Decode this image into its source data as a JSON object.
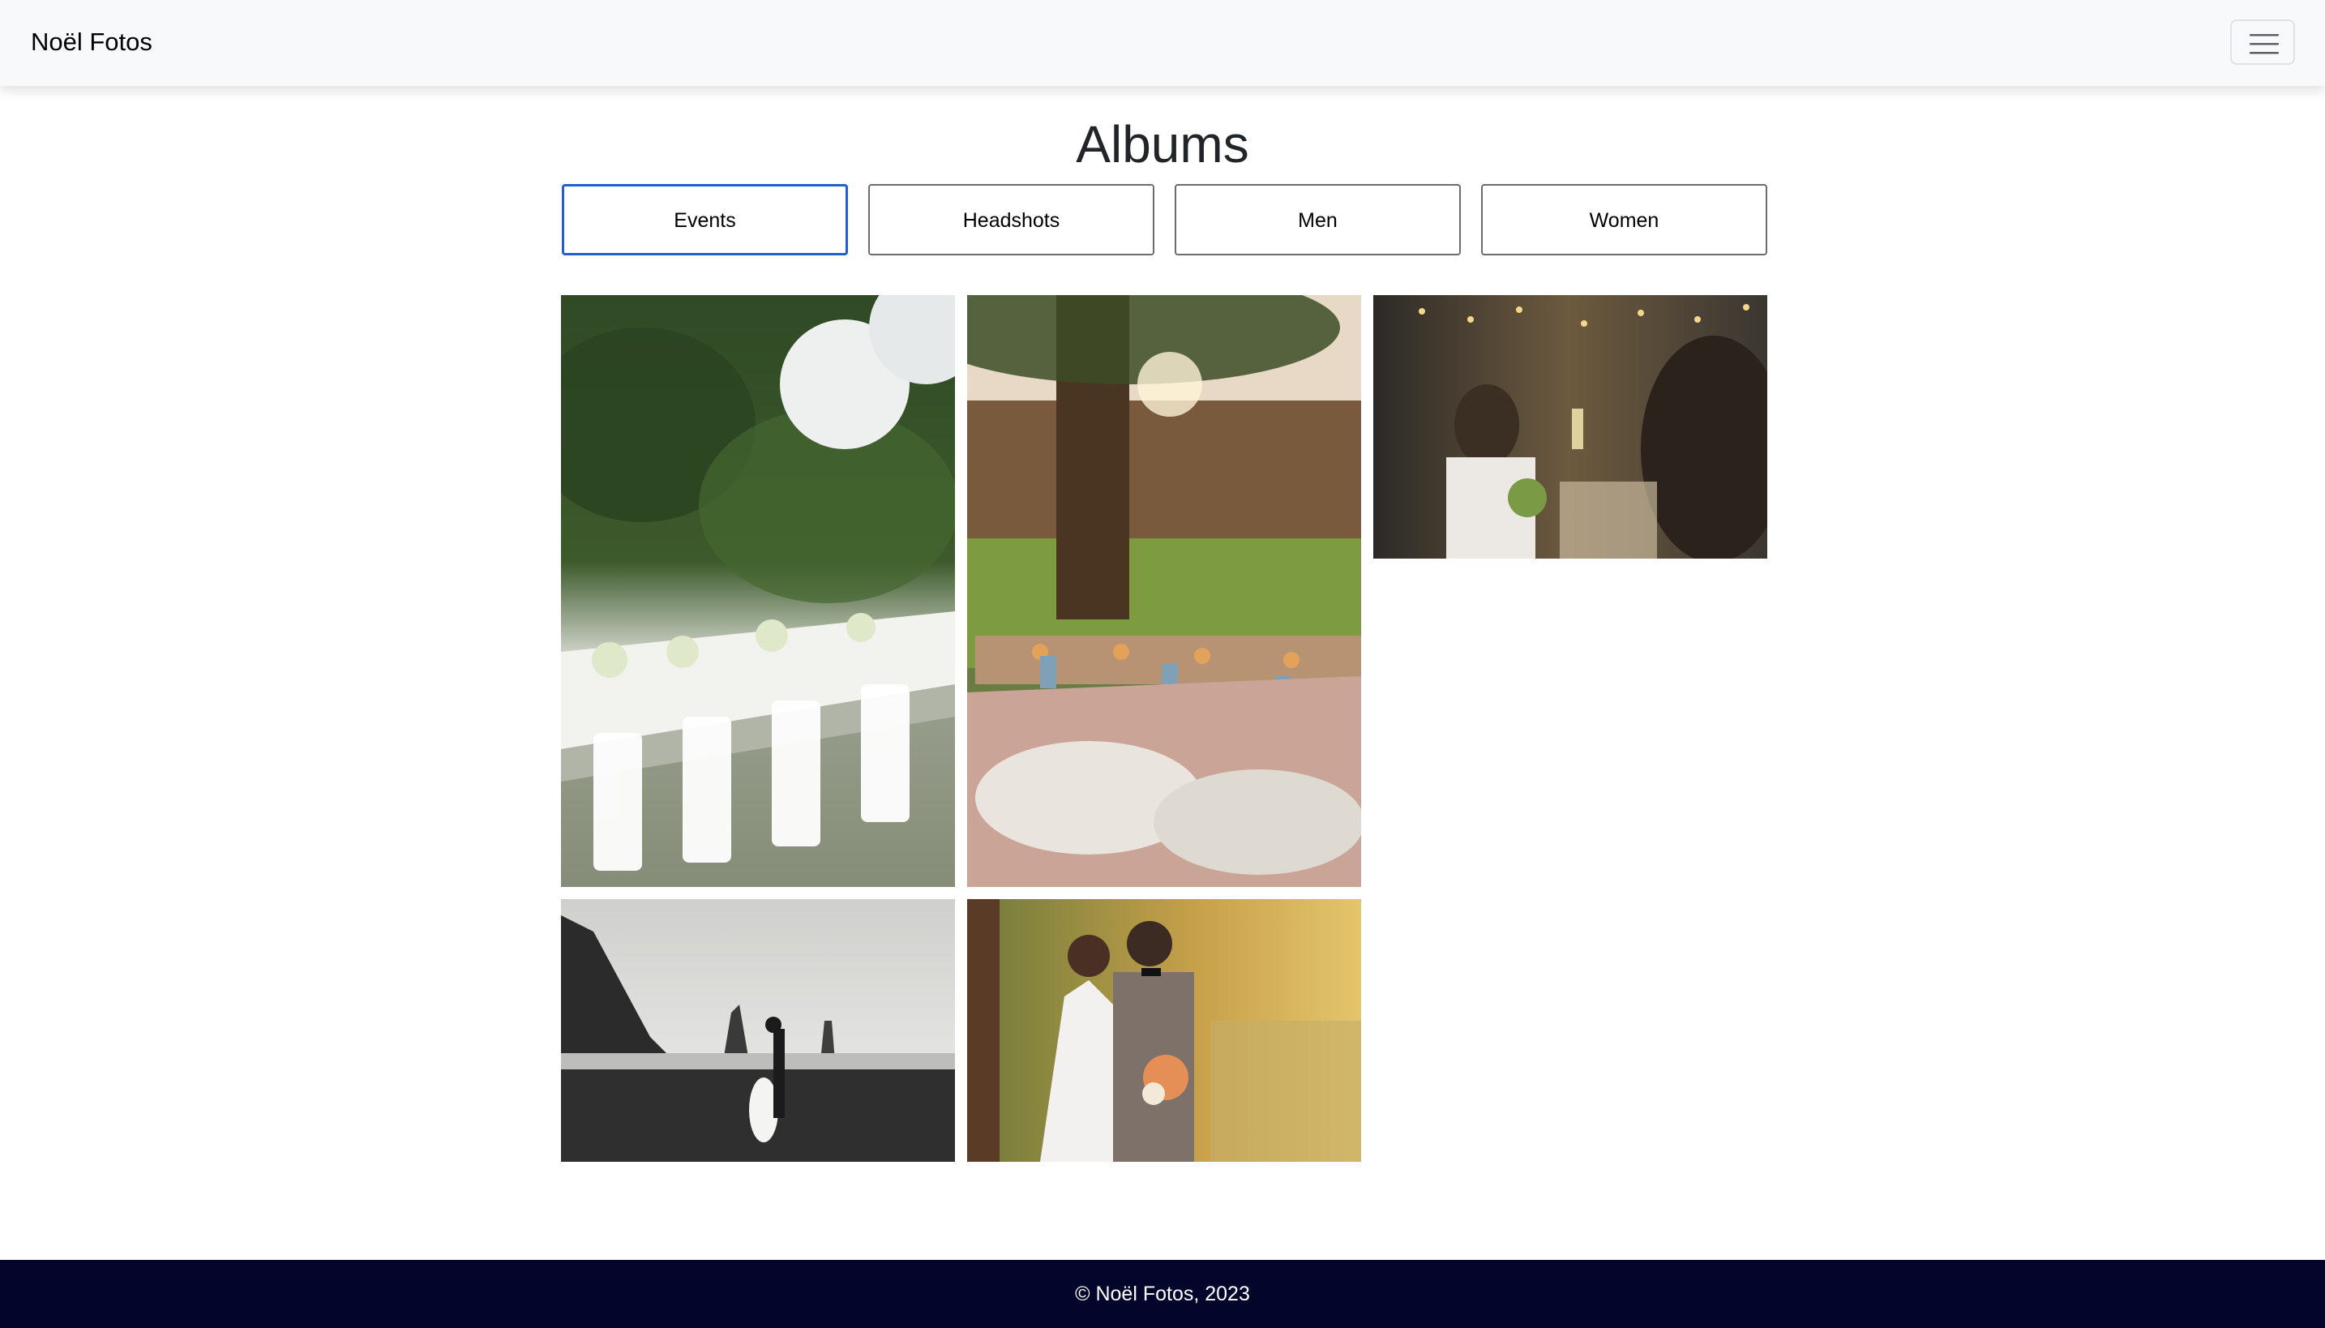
{
  "navbar": {
    "brand": "Noël Fotos",
    "menu_icon": "hamburger-menu-icon"
  },
  "page": {
    "title": "Albums"
  },
  "albums": [
    {
      "label": "Events",
      "active": true
    },
    {
      "label": "Headshots",
      "active": false
    },
    {
      "label": "Men",
      "active": false
    },
    {
      "label": "Women",
      "active": false
    }
  ],
  "photos": [
    {
      "subject": "outdoor wedding table with white chairs and paper lanterns"
    },
    {
      "subject": "backyard picnic table with candles, cushions and string lights"
    },
    {
      "subject": "guests toasting with champagne at indoor reception"
    },
    {
      "subject": "couple embracing on black sand beach"
    },
    {
      "subject": "bride and groom with bouquet by a lake in autumn"
    }
  ],
  "footer": {
    "text": "© Noël Fotos, 2023"
  },
  "colors": {
    "navbar_bg": "#f8f9fa",
    "active_border": "#1f5fd1",
    "footer_bg": "#03062a"
  }
}
